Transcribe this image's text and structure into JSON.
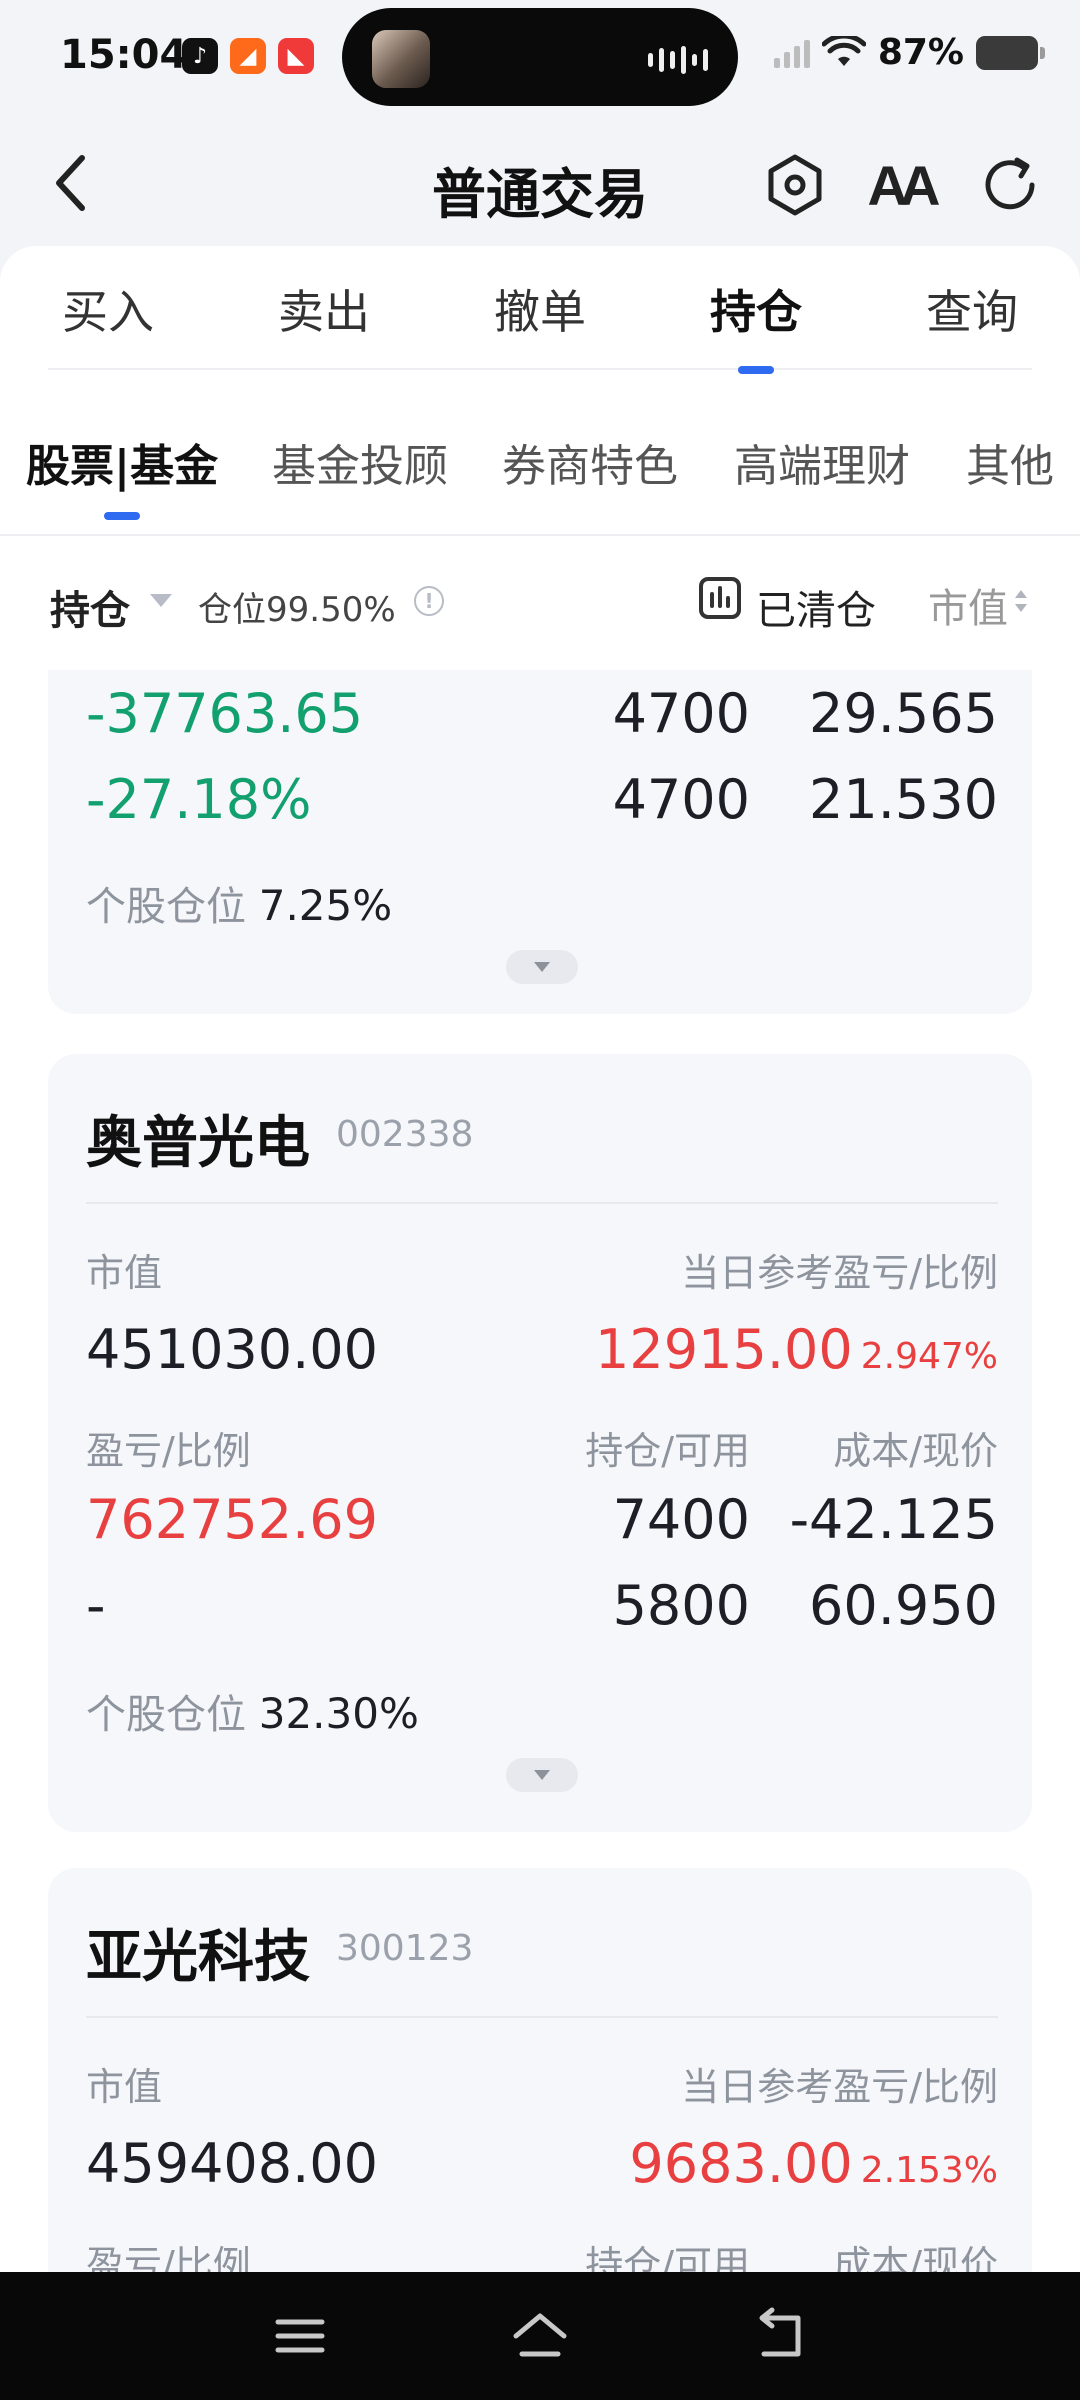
{
  "status_bar": {
    "time": "15:04",
    "battery": "87%",
    "app_icons": [
      {
        "name": "music-app-icon",
        "glyph": "♪",
        "color": "#111111"
      },
      {
        "name": "taobao-app-icon",
        "glyph": "◢",
        "color": "#ff6a1a"
      },
      {
        "name": "red-app-icon",
        "glyph": "◣",
        "color": "#f03a3a"
      }
    ]
  },
  "header": {
    "title": "普通交易",
    "font_button": "AA"
  },
  "main_tabs": [
    {
      "label": "买入"
    },
    {
      "label": "卖出"
    },
    {
      "label": "撤单"
    },
    {
      "label": "持仓",
      "active": true
    },
    {
      "label": "查询"
    }
  ],
  "sub_tabs": [
    {
      "label": "股票|基金",
      "active": true
    },
    {
      "label": "基金投顾"
    },
    {
      "label": "券商特色"
    },
    {
      "label": "高端理财"
    },
    {
      "label": "其他"
    }
  ],
  "filter_bar": {
    "holding_label": "持仓",
    "position_ratio": "仓位99.50%",
    "info": "!",
    "cleared_label": "已清仓",
    "sort_label": "市值"
  },
  "cards": [
    {
      "partial": true,
      "pl_value": "-37763.65",
      "pl_ratio": "-27.18%",
      "holding": "4700",
      "available": "4700",
      "cost": "29.565",
      "price": "21.530",
      "position_label": "个股仓位",
      "position_value": "7.25%"
    },
    {
      "name": "奥普光电",
      "code": "002338",
      "market_value_label": "市值",
      "market_value": "451030.00",
      "daily_pl_label": "当日参考盈亏/比例",
      "daily_pl": "12915.00",
      "daily_pl_ratio": "2.947%",
      "pl_label": "盈亏/比例",
      "hold_label": "持仓/可用",
      "cost_label": "成本/现价",
      "pl_value": "762752.69",
      "pl_ratio": "-",
      "holding": "7400",
      "available": "5800",
      "cost": "-42.125",
      "price": "60.950",
      "position_label": "个股仓位",
      "position_value": "32.30%"
    },
    {
      "name": "亚光科技",
      "code": "300123",
      "market_value_label": "市值",
      "market_value": "459408.00",
      "daily_pl_label": "当日参考盈亏/比例",
      "daily_pl": "9683.00",
      "daily_pl_ratio": "2.153%",
      "pl_label": "盈亏/比例",
      "hold_label": "持仓/可用",
      "cost_label": "成本/现价"
    }
  ],
  "colors": {
    "accent": "#2f6bf0",
    "profit": "#e84040",
    "loss": "#13a06f"
  }
}
